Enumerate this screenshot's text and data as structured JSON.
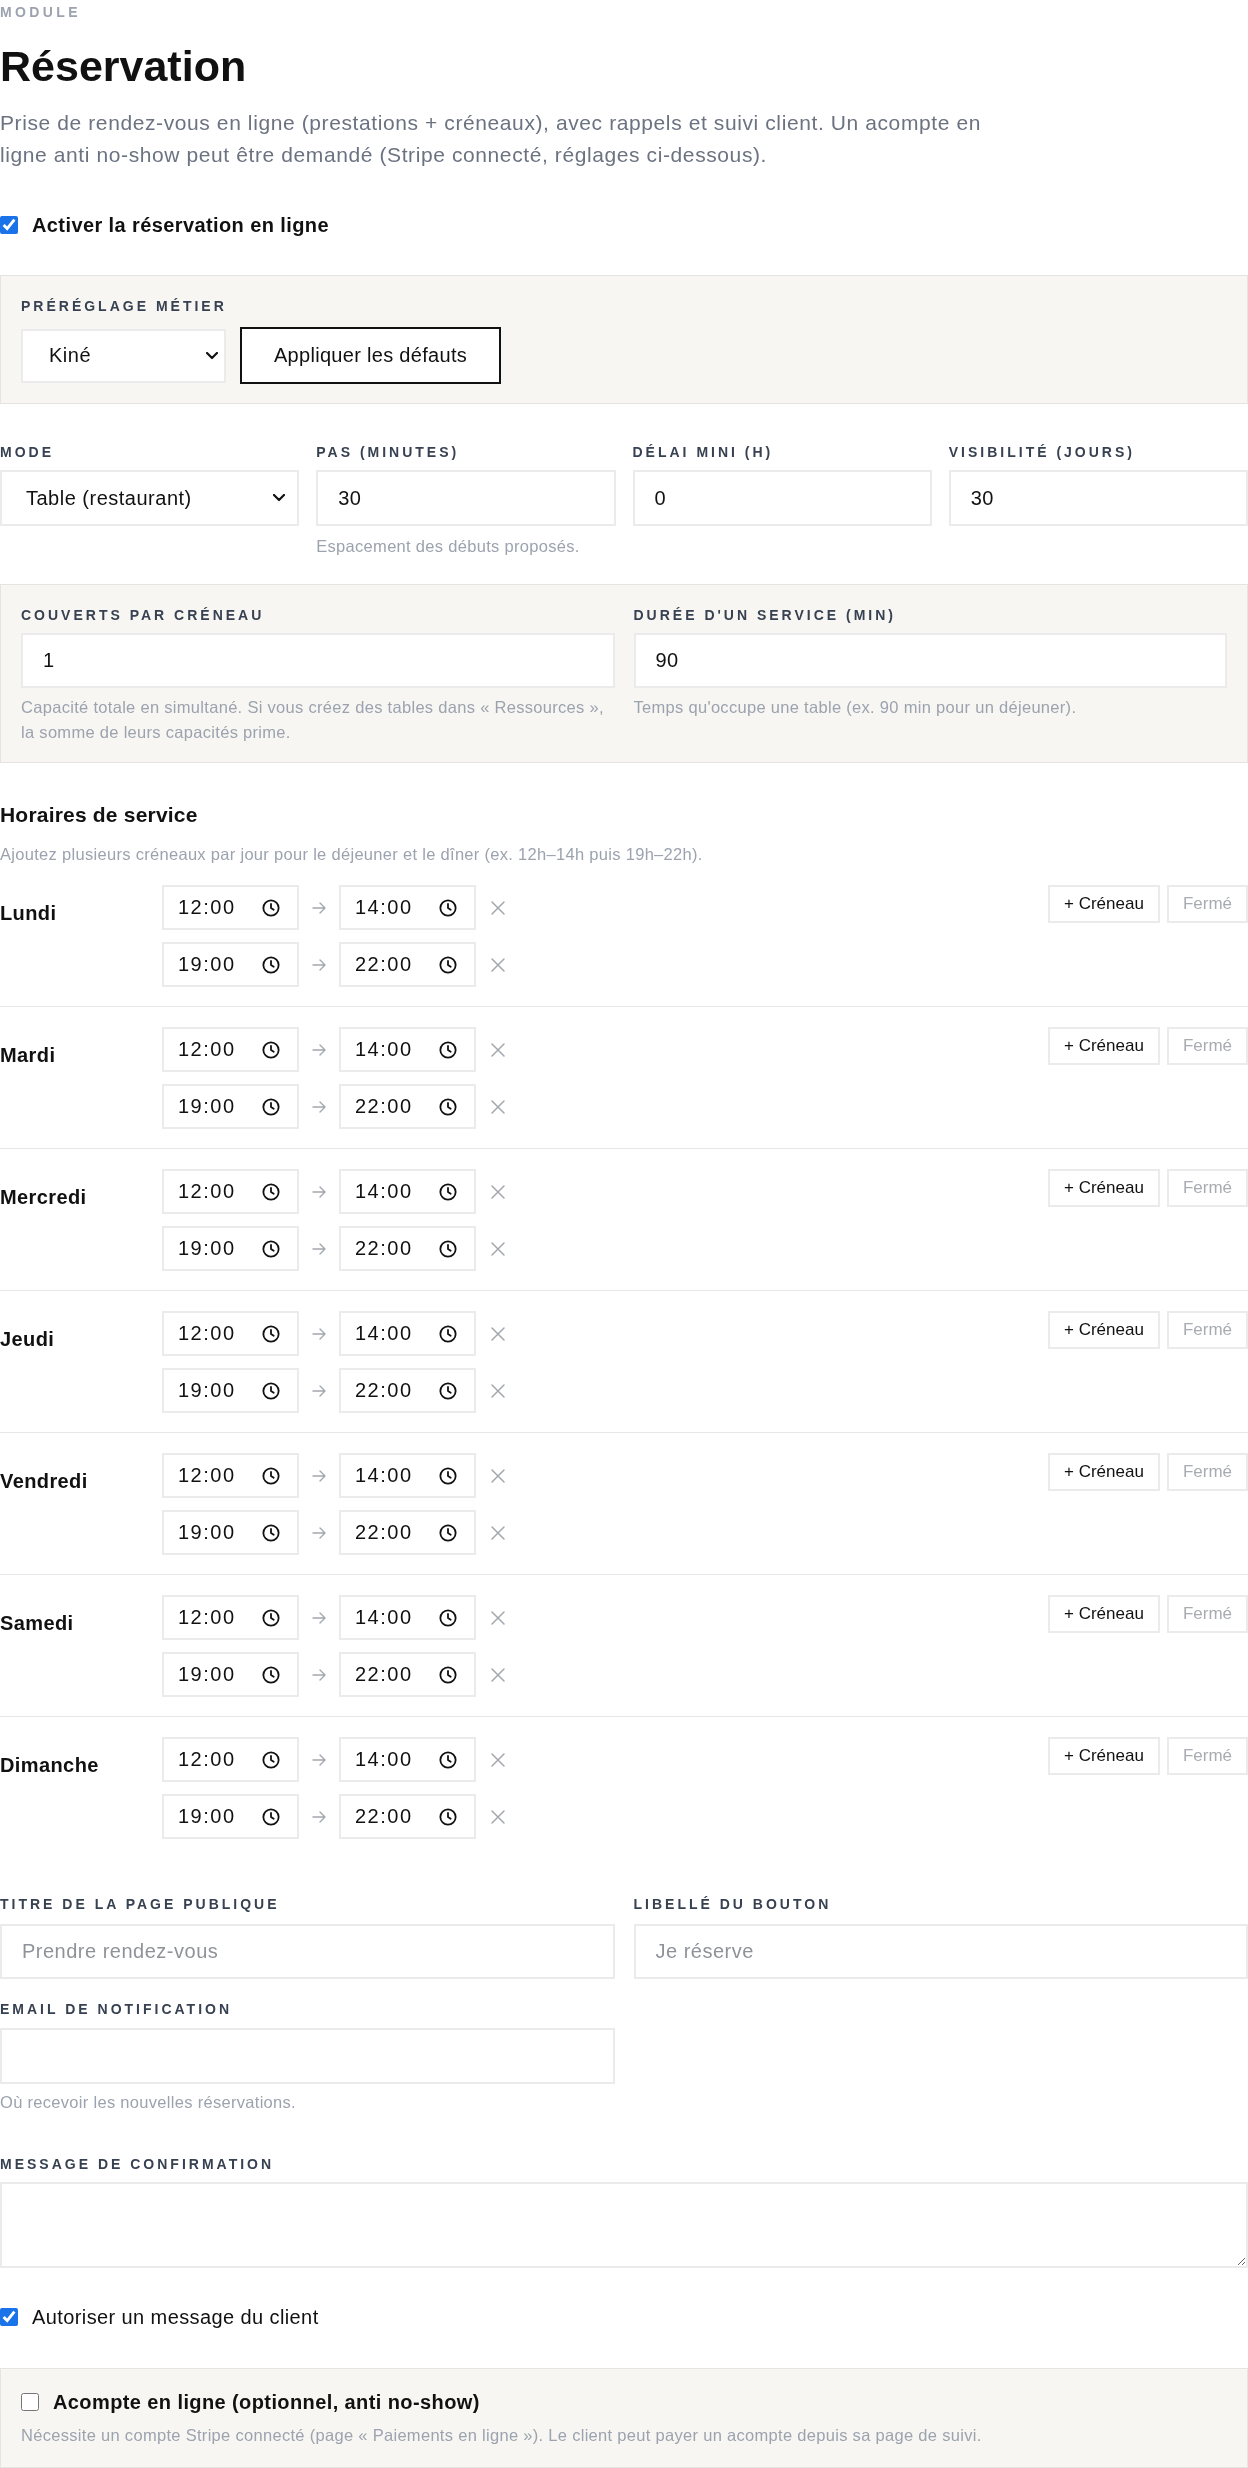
{
  "header": {
    "eyebrow": "MODULE",
    "title": "Réservation",
    "description": "Prise de rendez-vous en ligne (prestations + créneaux), avec rappels et suivi client. Un acompte en ligne anti no-show peut être demandé (Stripe connecté, réglages ci-dessous)."
  },
  "enable_booking": {
    "label": "Activer la réservation en ligne",
    "checked": true
  },
  "preset": {
    "label": "PRÉRÉGLAGE MÉTIER",
    "value": "Kiné",
    "button": "Appliquer les défauts"
  },
  "settings": [
    {
      "kind": "select",
      "label": "MODE",
      "value": "Table (restaurant)"
    },
    {
      "kind": "input",
      "label": "PAS (MINUTES)",
      "value": "30",
      "hint": "Espacement des débuts proposés."
    },
    {
      "kind": "input",
      "label": "DÉLAI MINI (H)",
      "value": "0"
    },
    {
      "kind": "input",
      "label": "VISIBILITÉ (JOURS)",
      "value": "30"
    }
  ],
  "capacity": [
    {
      "label": "COUVERTS PAR CRÉNEAU",
      "value": "1",
      "hint": "Capacité totale en simultané. Si vous créez des tables dans « Ressources », la somme de leurs capacités prime."
    },
    {
      "label": "DURÉE D'UN SERVICE (MIN)",
      "value": "90",
      "hint": "Temps qu'occupe une table (ex. 90 min pour un déjeuner)."
    }
  ],
  "service_hours": {
    "title": "Horaires de service",
    "hint": "Ajoutez plusieurs créneaux par jour pour le déjeuner et le dîner (ex. 12h–14h puis 19h–22h).",
    "days": [
      {
        "name": "Lundi",
        "slots": [
          {
            "start": "12:00",
            "end": "14:00"
          },
          {
            "start": "19:00",
            "end": "22:00"
          }
        ],
        "add_button": "+ Créneau",
        "closed_button": "Fermé",
        "closed": false
      },
      {
        "name": "Mardi",
        "slots": [
          {
            "start": "12:00",
            "end": "14:00"
          },
          {
            "start": "19:00",
            "end": "22:00"
          }
        ],
        "add_button": "+ Créneau",
        "closed_button": "Fermé",
        "closed": false
      },
      {
        "name": "Mercredi",
        "slots": [
          {
            "start": "12:00",
            "end": "14:00"
          },
          {
            "start": "19:00",
            "end": "22:00"
          }
        ],
        "add_button": "+ Créneau",
        "closed_button": "Fermé",
        "closed": false
      },
      {
        "name": "Jeudi",
        "slots": [
          {
            "start": "12:00",
            "end": "14:00"
          },
          {
            "start": "19:00",
            "end": "22:00"
          }
        ],
        "add_button": "+ Créneau",
        "closed_button": "Fermé",
        "closed": false
      },
      {
        "name": "Vendredi",
        "slots": [
          {
            "start": "12:00",
            "end": "14:00"
          },
          {
            "start": "19:00",
            "end": "22:00"
          }
        ],
        "add_button": "+ Créneau",
        "closed_button": "Fermé",
        "closed": false
      },
      {
        "name": "Samedi",
        "slots": [
          {
            "start": "12:00",
            "end": "14:00"
          },
          {
            "start": "19:00",
            "end": "22:00"
          }
        ],
        "add_button": "+ Créneau",
        "closed_button": "Fermé",
        "closed": false
      },
      {
        "name": "Dimanche",
        "slots": [
          {
            "start": "12:00",
            "end": "14:00"
          },
          {
            "start": "19:00",
            "end": "22:00"
          }
        ],
        "add_button": "+ Créneau",
        "closed_button": "Fermé",
        "closed": false
      }
    ]
  },
  "public_page": [
    {
      "label": "TITRE DE LA PAGE PUBLIQUE",
      "placeholder": "Prendre rendez-vous"
    },
    {
      "label": "LIBELLÉ DU BOUTON",
      "placeholder": "Je réserve"
    }
  ],
  "notification_email": {
    "label": "EMAIL DE NOTIFICATION",
    "hint": "Où recevoir les nouvelles réservations."
  },
  "confirmation_message": {
    "label": "MESSAGE DE CONFIRMATION"
  },
  "allow_client_message": {
    "label": "Autoriser un message du client",
    "checked": true
  },
  "deposit": {
    "label": "Acompte en ligne (optionnel, anti no-show)",
    "checked": false,
    "hint": "Nécessite un compte Stripe connecté (page « Paiements en ligne »). Le client peut payer un acompte depuis sa page de suivi."
  }
}
